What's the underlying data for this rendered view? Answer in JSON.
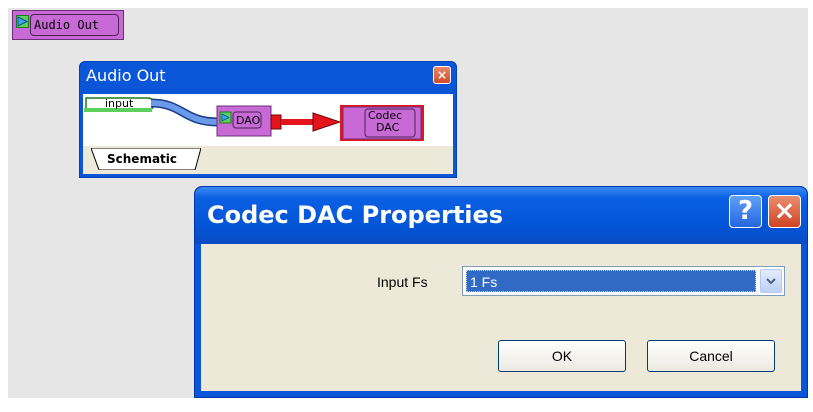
{
  "block": {
    "label": "Audio Out"
  },
  "schematic_window": {
    "title": "Audio Out",
    "close_glyph": "×",
    "input_label": "input",
    "dao_label": "DAO",
    "codec_label_line1": "Codec",
    "codec_label_line2": "DAC",
    "tab_label": "Schematic"
  },
  "dialog": {
    "title": "Codec DAC Properties",
    "help_glyph": "?",
    "close_glyph": "×",
    "field_label": "Input Fs",
    "field_value": "1 Fs",
    "ok_label": "OK",
    "cancel_label": "Cancel"
  },
  "colors": {
    "block_fill": "#c86ad6",
    "title_blue": "#0a55d8",
    "selection_blue": "#316ac5",
    "arrow_red": "#e3141b",
    "wire_blue": "#6a9ae8"
  }
}
